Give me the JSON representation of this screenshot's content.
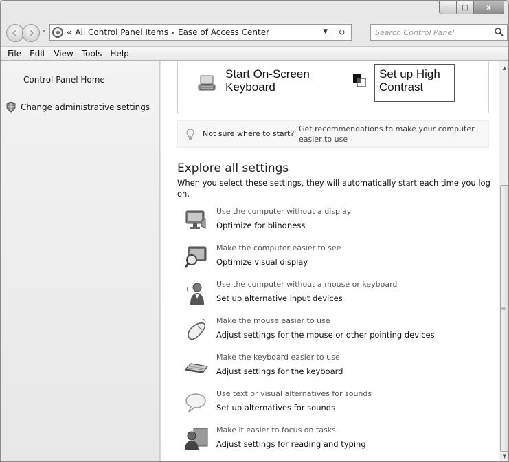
{
  "window": {
    "caption_buttons": {
      "minimize": "–",
      "maximize": "□",
      "close": "x"
    }
  },
  "nav": {
    "back_icon": "back-arrow-icon",
    "forward_icon": "forward-arrow-icon",
    "history_icon": "chevron-down-icon"
  },
  "address": {
    "overflow": "«",
    "crumbs": [
      "All Control Panel Items",
      "Ease of Access Center"
    ],
    "separator": "▸",
    "dropdown": "▼",
    "refresh": "↻"
  },
  "search": {
    "placeholder": "Search Control Panel"
  },
  "menu": [
    "File",
    "Edit",
    "View",
    "Tools",
    "Help"
  ],
  "left_pane": {
    "home_link": "Control Panel Home",
    "admin_link": "Change administrative settings"
  },
  "quick_access": {
    "keyboard_line1": "Start On-Screen",
    "keyboard_line2": "Keyboard",
    "contrast_line1": "Set up High",
    "contrast_line2": "Contrast"
  },
  "tip": {
    "question": "Not sure where to start?",
    "link_line1": "Get recommendations to make your computer",
    "link_line2": "easier to use"
  },
  "explore": {
    "title": "Explore all settings",
    "desc_line1": "When you select these settings, they will automatically start each time you log",
    "desc_line2": "on."
  },
  "settings": [
    {
      "icon": "monitor-speaker-icon",
      "sub": "Use the computer without a display",
      "link": "Optimize for blindness"
    },
    {
      "icon": "magnifier-monitor-icon",
      "sub": "Make the computer easier to see",
      "link": "Optimize visual display"
    },
    {
      "icon": "person-speech-icon",
      "sub": "Use the computer without a mouse or keyboard",
      "link": "Set up alternative input devices"
    },
    {
      "icon": "mouse-icon",
      "sub": "Make the mouse easier to use",
      "link": "Adjust settings for the mouse or other pointing devices"
    },
    {
      "icon": "keyboard-icon",
      "sub": "Make the keyboard easier to use",
      "link": "Adjust settings for the keyboard"
    },
    {
      "icon": "speech-bubble-icon",
      "sub": "Use text or visual alternatives for sounds",
      "link": "Set up alternatives for sounds"
    },
    {
      "icon": "focus-people-icon",
      "sub": "Make it easier to focus on tasks",
      "link": "Adjust settings for reading and typing"
    }
  ],
  "scrollbar": {
    "up": "▲",
    "down": "▼",
    "grip": "≡"
  }
}
